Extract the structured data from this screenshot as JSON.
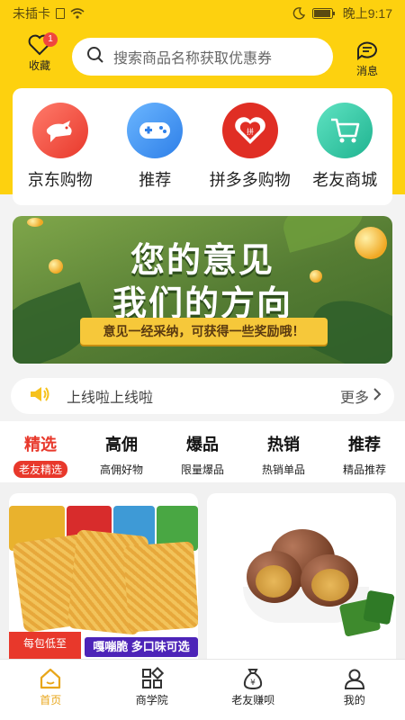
{
  "status_bar": {
    "carrier": "未插卡",
    "time": "晚上9:17"
  },
  "header": {
    "favorites_label": "收藏",
    "favorites_badge": "1",
    "search_placeholder": "搜索商品名称获取优惠券",
    "messages_label": "消息"
  },
  "categories": [
    {
      "label": "京东购物",
      "icon": "jd-dog-icon",
      "color": "#f0463d"
    },
    {
      "label": "推荐",
      "icon": "gamepad-icon",
      "color": "#3a8ef0"
    },
    {
      "label": "拼多多购物",
      "icon": "pinduoduo-icon",
      "color": "#e02e24"
    },
    {
      "label": "老友商城",
      "icon": "shopping-cart-icon",
      "color": "#2fc6a6"
    }
  ],
  "banner": {
    "line1": "您的意见",
    "line2": "我们的方向",
    "ribbon": "意见一经采纳，可获得一些奖励哦！"
  },
  "notice": {
    "text": "上线啦上线啦",
    "more_label": "更多"
  },
  "tabs": [
    {
      "label": "精选",
      "sub": "老友精选",
      "active": true
    },
    {
      "label": "高佣",
      "sub": "高佣好物",
      "active": false
    },
    {
      "label": "爆品",
      "sub": "限量爆品",
      "active": false
    },
    {
      "label": "热销",
      "sub": "热销单品",
      "active": false
    },
    {
      "label": "推荐",
      "sub": "精品推荐",
      "active": false
    }
  ],
  "products": [
    {
      "promo_left": "每包低至",
      "promo_right": "嘎嘣脆 多口味可选"
    },
    {
      "promo_left": "",
      "promo_right": ""
    }
  ],
  "bottom_nav": [
    {
      "label": "首页",
      "icon": "home-icon",
      "active": true
    },
    {
      "label": "商学院",
      "icon": "grid-icon",
      "active": false
    },
    {
      "label": "老友赚呗",
      "icon": "money-bag-icon",
      "active": false
    },
    {
      "label": "我的",
      "icon": "user-icon",
      "active": false
    }
  ],
  "colors": {
    "brand_yellow": "#fdd10f",
    "accent_red": "#e8382b",
    "nav_active": "#e8a61a"
  }
}
